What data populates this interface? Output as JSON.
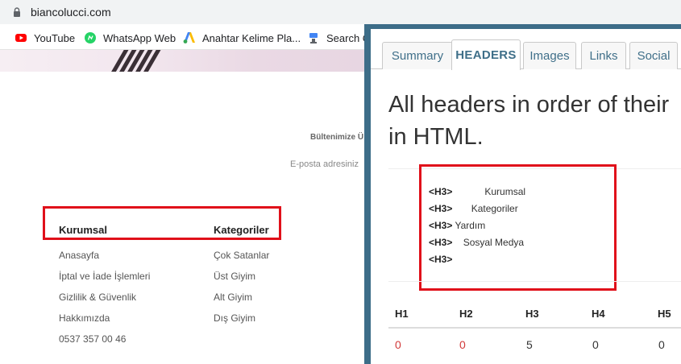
{
  "browser": {
    "url": "biancolucci.com",
    "bookmarks": [
      {
        "label": "YouTube",
        "icon": "youtube-icon"
      },
      {
        "label": "WhatsApp Web",
        "icon": "whatsapp-icon"
      },
      {
        "label": "Anahtar Kelime Pla...",
        "icon": "google-ads-icon"
      },
      {
        "label": "Search C",
        "icon": "search-console-icon"
      }
    ]
  },
  "site": {
    "newsletter_title": "Bültenimize Ü",
    "email_hint": "E-posta adresiniz",
    "columns": [
      {
        "heading": "Kurumsal",
        "items": [
          "Anasayfa",
          "İptal ve İade İşlemleri",
          "Gizlilik & Güvenlik",
          "Hakkımızda",
          "0537 357 00 46"
        ]
      },
      {
        "heading": "Kategoriler",
        "items": [
          "Çok Satanlar",
          "Üst Giyim",
          "Alt Giyim",
          "Dış Giyim"
        ]
      }
    ]
  },
  "panel": {
    "tabs": [
      "Summary",
      "HEADERS",
      "Images",
      "Links",
      "Social"
    ],
    "active_tab": "HEADERS",
    "headline": "All headers in order of their appearance in HTML.",
    "headline_visible_line1": "All headers in order of their",
    "headline_visible_line2": "in HTML.",
    "headers": [
      {
        "tag": "<H3>",
        "text": "            Kurumsal"
      },
      {
        "tag": "<H3>",
        "text": "       Kategoriler"
      },
      {
        "tag": "<H3>",
        "text": " Yardım"
      },
      {
        "tag": "<H3>",
        "text": "    Sosyal Medya"
      },
      {
        "tag": "<H3>",
        "text": ""
      }
    ],
    "counts": {
      "labels": [
        "H1",
        "H2",
        "H3",
        "H4",
        "H5"
      ],
      "values": [
        "0",
        "0",
        "5",
        "0",
        "0"
      ]
    }
  },
  "colors": {
    "highlight_red": "#e0101a",
    "panel_accent": "#3d6d88",
    "zero_count_red": "#d23a3a"
  }
}
